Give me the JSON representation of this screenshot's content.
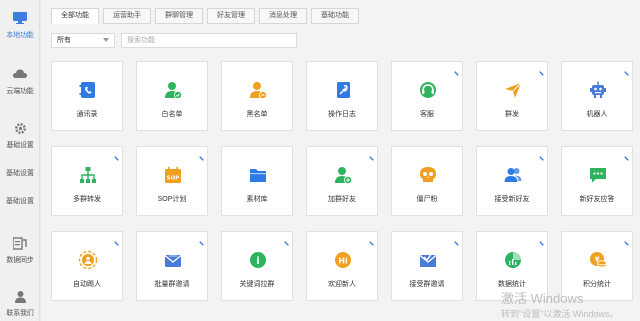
{
  "sidebar": {
    "items": [
      {
        "label": "本地功能",
        "icon": "monitor-icon",
        "active": true
      },
      {
        "label": "云端功能",
        "icon": "cloud-icon",
        "active": false
      },
      {
        "label": "基础设置",
        "icon": "gear-icon",
        "active": false
      },
      {
        "label": "基础设置",
        "icon": "none",
        "active": false
      },
      {
        "label": "基础设置",
        "icon": "none",
        "active": false
      },
      {
        "label": "数据同步",
        "icon": "sync-icon",
        "active": false
      },
      {
        "label": "联系我们",
        "icon": "person-icon",
        "active": false
      }
    ]
  },
  "tabs": [
    {
      "label": "全部功能",
      "active": true
    },
    {
      "label": "运营助手",
      "active": false
    },
    {
      "label": "群聊管理",
      "active": false
    },
    {
      "label": "好友管理",
      "active": false
    },
    {
      "label": "消息处理",
      "active": false
    },
    {
      "label": "基础功能",
      "active": false
    }
  ],
  "filter": {
    "selected": "所有",
    "search_placeholder": "搜索功能"
  },
  "cards": [
    {
      "label": "通讯录",
      "icon": "contacts-icon",
      "color": "#2f7be5",
      "pinned": false
    },
    {
      "label": "白名单",
      "icon": "user-check-icon",
      "color": "#2fb35f",
      "pinned": false
    },
    {
      "label": "黑名单",
      "icon": "user-block-icon",
      "color": "#f0a020",
      "pinned": false
    },
    {
      "label": "操作日志",
      "icon": "wrench-icon",
      "color": "#2f7be5",
      "pinned": false
    },
    {
      "label": "客服",
      "icon": "headset-icon",
      "color": "#2fb35f",
      "pinned": true
    },
    {
      "label": "群发",
      "icon": "send-icon",
      "color": "#f0a020",
      "pinned": true
    },
    {
      "label": "机器人",
      "icon": "robot-icon",
      "color": "#4a7bd8",
      "pinned": true
    },
    {
      "label": "多群转发",
      "icon": "org-chart-icon",
      "color": "#2fb35f",
      "pinned": true
    },
    {
      "label": "SOP计划",
      "icon": "calendar-icon",
      "color": "#f0a020",
      "pinned": true
    },
    {
      "label": "素材库",
      "icon": "folder-icon",
      "color": "#2f7be5",
      "pinned": false
    },
    {
      "label": "加群好友",
      "icon": "user-add-icon",
      "color": "#2fb35f",
      "pinned": true
    },
    {
      "label": "僵尸粉",
      "icon": "skull-icon",
      "color": "#f0a020",
      "pinned": false
    },
    {
      "label": "接受新好友",
      "icon": "users-icon",
      "color": "#2f7be5",
      "pinned": true
    },
    {
      "label": "新好友应答",
      "icon": "chat-icon",
      "color": "#2fb35f",
      "pinned": true
    },
    {
      "label": "自动踢人",
      "icon": "kick-icon",
      "color": "#f0a020",
      "pinned": true
    },
    {
      "label": "批量群邀请",
      "icon": "mail-icon",
      "color": "#4a7bd8",
      "pinned": true
    },
    {
      "label": "关键词拉群",
      "icon": "keyword-icon",
      "color": "#2fb35f",
      "pinned": true
    },
    {
      "label": "欢迎新人",
      "icon": "hi-icon",
      "color": "#f0a020",
      "pinned": true
    },
    {
      "label": "接受群邀请",
      "icon": "mail-check-icon",
      "color": "#4a7bd8",
      "pinned": true
    },
    {
      "label": "数据统计",
      "icon": "pie-chart-icon",
      "color": "#2fb35f",
      "pinned": true
    },
    {
      "label": "积分统计",
      "icon": "coins-icon",
      "color": "#f0a020",
      "pinned": true
    }
  ],
  "watermark": {
    "line1": "激活 Windows",
    "line2": "转到\"设置\"以激活 Windows。"
  }
}
